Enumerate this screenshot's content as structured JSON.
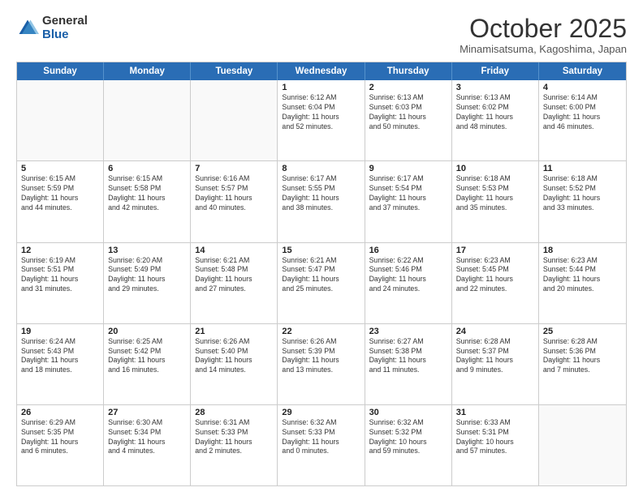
{
  "header": {
    "logo_general": "General",
    "logo_blue": "Blue",
    "month_title": "October 2025",
    "location": "Minamisatsuma, Kagoshima, Japan"
  },
  "weekdays": [
    "Sunday",
    "Monday",
    "Tuesday",
    "Wednesday",
    "Thursday",
    "Friday",
    "Saturday"
  ],
  "rows": [
    [
      {
        "day": "",
        "text": "",
        "empty": true
      },
      {
        "day": "",
        "text": "",
        "empty": true
      },
      {
        "day": "",
        "text": "",
        "empty": true
      },
      {
        "day": "1",
        "text": "Sunrise: 6:12 AM\nSunset: 6:04 PM\nDaylight: 11 hours\nand 52 minutes."
      },
      {
        "day": "2",
        "text": "Sunrise: 6:13 AM\nSunset: 6:03 PM\nDaylight: 11 hours\nand 50 minutes."
      },
      {
        "day": "3",
        "text": "Sunrise: 6:13 AM\nSunset: 6:02 PM\nDaylight: 11 hours\nand 48 minutes."
      },
      {
        "day": "4",
        "text": "Sunrise: 6:14 AM\nSunset: 6:00 PM\nDaylight: 11 hours\nand 46 minutes."
      }
    ],
    [
      {
        "day": "5",
        "text": "Sunrise: 6:15 AM\nSunset: 5:59 PM\nDaylight: 11 hours\nand 44 minutes."
      },
      {
        "day": "6",
        "text": "Sunrise: 6:15 AM\nSunset: 5:58 PM\nDaylight: 11 hours\nand 42 minutes."
      },
      {
        "day": "7",
        "text": "Sunrise: 6:16 AM\nSunset: 5:57 PM\nDaylight: 11 hours\nand 40 minutes."
      },
      {
        "day": "8",
        "text": "Sunrise: 6:17 AM\nSunset: 5:55 PM\nDaylight: 11 hours\nand 38 minutes."
      },
      {
        "day": "9",
        "text": "Sunrise: 6:17 AM\nSunset: 5:54 PM\nDaylight: 11 hours\nand 37 minutes."
      },
      {
        "day": "10",
        "text": "Sunrise: 6:18 AM\nSunset: 5:53 PM\nDaylight: 11 hours\nand 35 minutes."
      },
      {
        "day": "11",
        "text": "Sunrise: 6:18 AM\nSunset: 5:52 PM\nDaylight: 11 hours\nand 33 minutes."
      }
    ],
    [
      {
        "day": "12",
        "text": "Sunrise: 6:19 AM\nSunset: 5:51 PM\nDaylight: 11 hours\nand 31 minutes."
      },
      {
        "day": "13",
        "text": "Sunrise: 6:20 AM\nSunset: 5:49 PM\nDaylight: 11 hours\nand 29 minutes."
      },
      {
        "day": "14",
        "text": "Sunrise: 6:21 AM\nSunset: 5:48 PM\nDaylight: 11 hours\nand 27 minutes."
      },
      {
        "day": "15",
        "text": "Sunrise: 6:21 AM\nSunset: 5:47 PM\nDaylight: 11 hours\nand 25 minutes."
      },
      {
        "day": "16",
        "text": "Sunrise: 6:22 AM\nSunset: 5:46 PM\nDaylight: 11 hours\nand 24 minutes."
      },
      {
        "day": "17",
        "text": "Sunrise: 6:23 AM\nSunset: 5:45 PM\nDaylight: 11 hours\nand 22 minutes."
      },
      {
        "day": "18",
        "text": "Sunrise: 6:23 AM\nSunset: 5:44 PM\nDaylight: 11 hours\nand 20 minutes."
      }
    ],
    [
      {
        "day": "19",
        "text": "Sunrise: 6:24 AM\nSunset: 5:43 PM\nDaylight: 11 hours\nand 18 minutes."
      },
      {
        "day": "20",
        "text": "Sunrise: 6:25 AM\nSunset: 5:42 PM\nDaylight: 11 hours\nand 16 minutes."
      },
      {
        "day": "21",
        "text": "Sunrise: 6:26 AM\nSunset: 5:40 PM\nDaylight: 11 hours\nand 14 minutes."
      },
      {
        "day": "22",
        "text": "Sunrise: 6:26 AM\nSunset: 5:39 PM\nDaylight: 11 hours\nand 13 minutes."
      },
      {
        "day": "23",
        "text": "Sunrise: 6:27 AM\nSunset: 5:38 PM\nDaylight: 11 hours\nand 11 minutes."
      },
      {
        "day": "24",
        "text": "Sunrise: 6:28 AM\nSunset: 5:37 PM\nDaylight: 11 hours\nand 9 minutes."
      },
      {
        "day": "25",
        "text": "Sunrise: 6:28 AM\nSunset: 5:36 PM\nDaylight: 11 hours\nand 7 minutes."
      }
    ],
    [
      {
        "day": "26",
        "text": "Sunrise: 6:29 AM\nSunset: 5:35 PM\nDaylight: 11 hours\nand 6 minutes."
      },
      {
        "day": "27",
        "text": "Sunrise: 6:30 AM\nSunset: 5:34 PM\nDaylight: 11 hours\nand 4 minutes."
      },
      {
        "day": "28",
        "text": "Sunrise: 6:31 AM\nSunset: 5:33 PM\nDaylight: 11 hours\nand 2 minutes."
      },
      {
        "day": "29",
        "text": "Sunrise: 6:32 AM\nSunset: 5:33 PM\nDaylight: 11 hours\nand 0 minutes."
      },
      {
        "day": "30",
        "text": "Sunrise: 6:32 AM\nSunset: 5:32 PM\nDaylight: 10 hours\nand 59 minutes."
      },
      {
        "day": "31",
        "text": "Sunrise: 6:33 AM\nSunset: 5:31 PM\nDaylight: 10 hours\nand 57 minutes."
      },
      {
        "day": "",
        "text": "",
        "empty": true
      }
    ]
  ]
}
